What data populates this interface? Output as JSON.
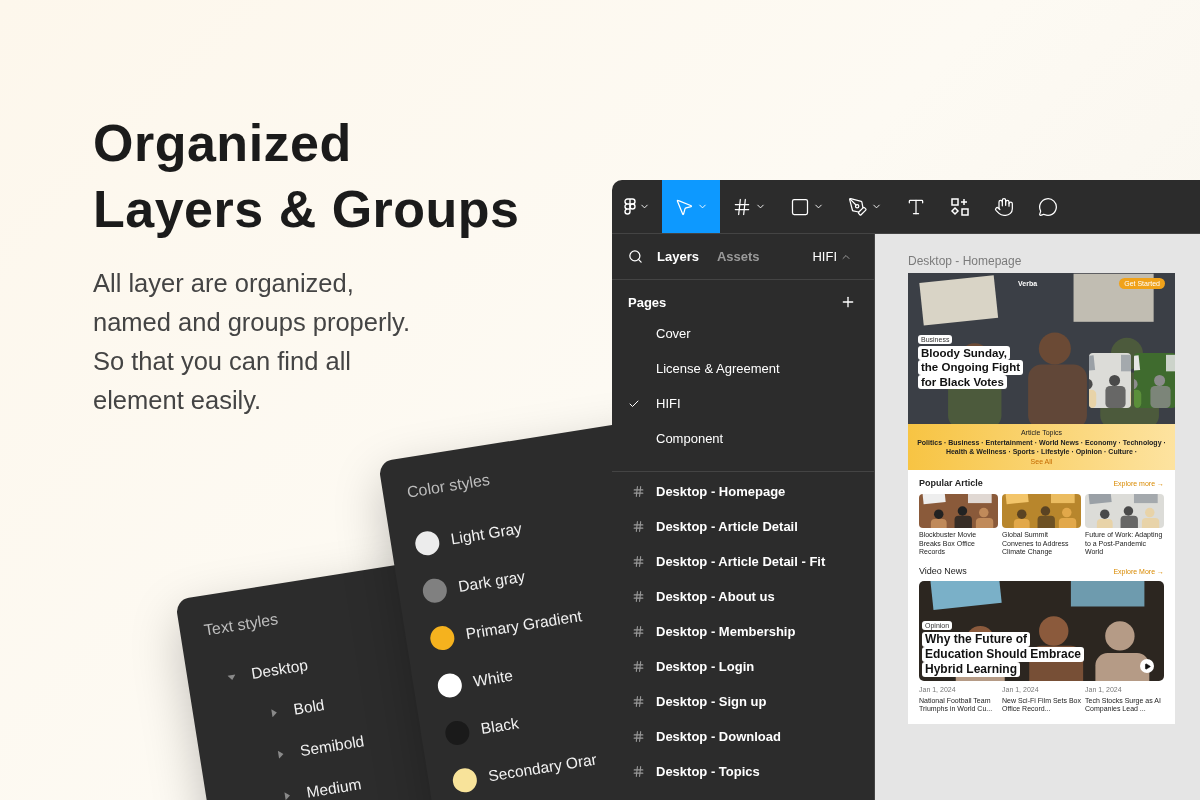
{
  "hero": {
    "title_lines": [
      "Organized",
      "Layers & Groups"
    ],
    "text": "All layer are organized, named and groups properly. So that you can find all element easily."
  },
  "text_styles": {
    "title": "Text styles",
    "tree": [
      {
        "label": "Desktop",
        "expanded": true,
        "children": [
          {
            "label": "Bold",
            "expanded": false
          },
          {
            "label": "Semibold",
            "expanded": false
          },
          {
            "label": "Medium",
            "expanded": false
          }
        ]
      }
    ]
  },
  "color_styles": {
    "title": "Color styles",
    "items": [
      {
        "label": "Light Gray",
        "color": "#ececec"
      },
      {
        "label": "Dark gray",
        "color": "#808080"
      },
      {
        "label": "Primary Gradient",
        "color": "#f5b21e"
      },
      {
        "label": "White",
        "color": "#ffffff"
      },
      {
        "label": "Black",
        "color": "#1a1a1a"
      },
      {
        "label": "Secondary Orar",
        "color": "#f8e39a"
      }
    ]
  },
  "toolbar": {
    "tools": [
      {
        "kind": "logo",
        "selected": false,
        "menu": true
      },
      {
        "kind": "move",
        "selected": true,
        "menu": true
      },
      {
        "kind": "frame",
        "selected": false,
        "menu": true
      },
      {
        "kind": "shape",
        "selected": false,
        "menu": true
      },
      {
        "kind": "pen",
        "selected": false,
        "menu": true
      },
      {
        "kind": "text",
        "selected": false,
        "menu": false
      },
      {
        "kind": "resources",
        "selected": false,
        "menu": false
      },
      {
        "kind": "hand",
        "selected": false,
        "menu": false
      },
      {
        "kind": "comment",
        "selected": false,
        "menu": false
      }
    ]
  },
  "panel": {
    "tabs": [
      {
        "label": "Layers",
        "selected": true
      },
      {
        "label": "Assets",
        "selected": false
      }
    ],
    "page_switch": "HIFI",
    "pages_title": "Pages",
    "pages": [
      {
        "label": "Cover",
        "selected": false
      },
      {
        "label": "License & Agreement",
        "selected": false
      },
      {
        "label": "HIFI",
        "selected": true
      },
      {
        "label": "Component",
        "selected": false
      }
    ],
    "layers": [
      "Desktop - Homepage",
      "Desktop - Article Detail",
      "Desktop - Article Detail - Fit",
      "Desktop - About us",
      "Desktop - Membership",
      "Desktop - Login",
      "Desktop - Sign up",
      "Desktop - Download",
      "Desktop - Topics"
    ]
  },
  "canvas": {
    "frame_label": "Desktop - Homepage",
    "site": {
      "logo": "Verba",
      "cta": "Get Started",
      "hero": {
        "tag": "Business",
        "headline_lines": [
          "Bloody Sunday,",
          "the Ongoing Fight",
          "for Black Votes"
        ]
      },
      "topics": {
        "title": "Article Topics",
        "text": "Politics · Business · Entertainment · World News · Economy · Technology · Health & Wellness · Sports · Lifestyle · Opinion · Culture ·",
        "more": "See All"
      },
      "popular": {
        "title": "Popular Article",
        "link": "Explore more →",
        "articles": [
          {
            "title": "Blockbuster Movie Breaks Box Office Records"
          },
          {
            "title": "Global Summit Convenes to Address Climate Change"
          },
          {
            "title": "Future of Work: Adapting to a Post-Pandemic World"
          }
        ]
      },
      "video": {
        "title": "Video News",
        "link": "Explore More →",
        "tag": "Opinion",
        "headline_lines": [
          "Why the Future of",
          "Education Should Embrace",
          "Hybrid Learning"
        ],
        "items": [
          {
            "date": "Jan 1, 2024",
            "title": "National Football Team Triumphs in World Cu..."
          },
          {
            "date": "Jan 1, 2024",
            "title": "New Sci-Fi Film Sets Box Office Record..."
          },
          {
            "date": "Jan 1, 2024",
            "title": "Tech Stocks Surge as AI Companies Lead ..."
          }
        ]
      }
    }
  }
}
